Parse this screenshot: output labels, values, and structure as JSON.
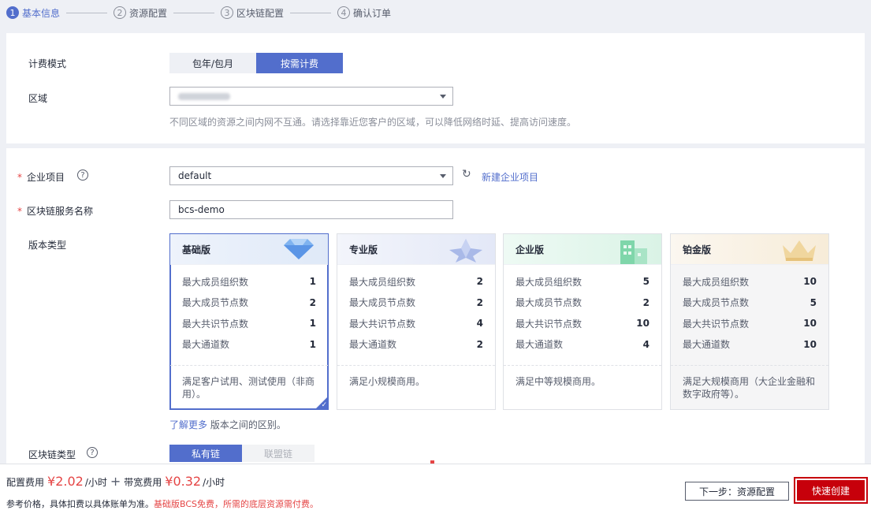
{
  "steps": [
    {
      "num": "1",
      "label": "基本信息"
    },
    {
      "num": "2",
      "label": "资源配置"
    },
    {
      "num": "3",
      "label": "区块链配置"
    },
    {
      "num": "4",
      "label": "确认订单"
    }
  ],
  "billing": {
    "label": "计费模式",
    "options": [
      "包年/包月",
      "按需计费"
    ]
  },
  "region": {
    "label": "区域",
    "hint": "不同区域的资源之间内网不互通。请选择靠近您客户的区域，可以降低网络时延、提高访问速度。"
  },
  "enterprise": {
    "label": "企业项目",
    "value": "default",
    "new_link": "新建企业项目",
    "help": "?"
  },
  "service_name": {
    "label": "区块链服务名称",
    "value": "bcs-demo"
  },
  "version": {
    "label": "版本类型",
    "row_labels": [
      "最大成员组织数",
      "最大成员节点数",
      "最大共识节点数",
      "最大通道数"
    ],
    "cards": [
      {
        "name": "基础版",
        "values": [
          "1",
          "2",
          "1",
          "1"
        ],
        "desc": "满足客户试用、测试使用（非商用）。"
      },
      {
        "name": "专业版",
        "values": [
          "2",
          "2",
          "4",
          "2"
        ],
        "desc": "满足小规模商用。"
      },
      {
        "name": "企业版",
        "values": [
          "5",
          "2",
          "10",
          "4"
        ],
        "desc": "满足中等规模商用。"
      },
      {
        "name": "铂金版",
        "values": [
          "10",
          "5",
          "10",
          "10"
        ],
        "desc": "满足大规模商用（大企业金融和数字政府等）。"
      }
    ],
    "learn_more": "了解更多",
    "learn_more_suffix": " 版本之间的区别。"
  },
  "chain_type": {
    "label": "区块链类型",
    "help": "?",
    "options": [
      "私有链",
      "联盟链"
    ]
  },
  "footer": {
    "config_fee_label": "配置费用",
    "config_fee": "¥2.02",
    "per_hour": "/小时",
    "plus": "+",
    "bandwidth_label": "带宽费用",
    "bandwidth_fee": "¥0.32",
    "per_hour2": "/小时",
    "ref_text": "参考价格，具体扣费以具体账单为准。",
    "ref_note": "基础版BCS免费，所需的底层资源需付费。",
    "next_button": "下一步：资源配置",
    "create_button": "快速创建"
  },
  "colors": {
    "accent": "#526ecc",
    "danger": "#c7000b",
    "price": "#e54545"
  }
}
